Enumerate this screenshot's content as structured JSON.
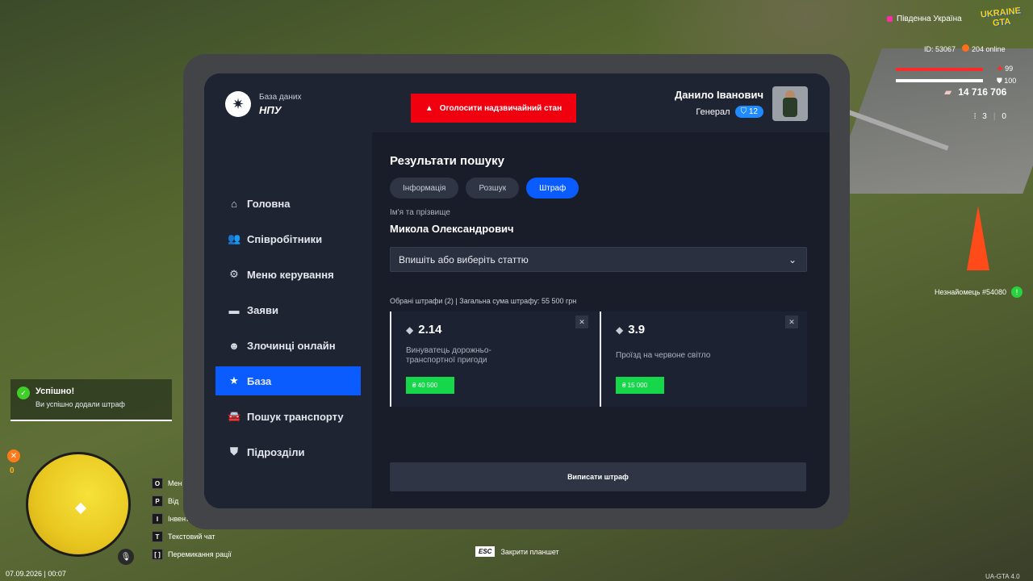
{
  "tablet": {
    "logo_sub": "База даних",
    "logo_main": "НПУ",
    "alarm_label": "Оголосити надзвичайний стан",
    "user_name": "Данило Іванович",
    "user_rank": "Генерал",
    "rank_level": "12",
    "nav": [
      {
        "label": "Головна",
        "icon": "home-icon"
      },
      {
        "label": "Співробітники",
        "icon": "people-icon"
      },
      {
        "label": "Меню керування",
        "icon": "gear-icon"
      },
      {
        "label": "Заяви",
        "icon": "folder-icon"
      },
      {
        "label": "Злочинці онлайн",
        "icon": "face-icon"
      },
      {
        "label": "База",
        "icon": "star-icon",
        "active": true
      },
      {
        "label": "Пошук транспорту",
        "icon": "car-icon"
      },
      {
        "label": "Підрозділи",
        "icon": "shield-icon"
      }
    ],
    "results_title": "Результати пошуку",
    "tabs": [
      "Інформація",
      "Розшук",
      "Штраф"
    ],
    "active_tab": "Штраф",
    "name_label": "Ім'я та прізвище",
    "name_value": "Микола Олександрович",
    "select_placeholder": "Впишіть або виберіть статтю",
    "summary": "Обрані штрафи (2) | Загальна сума штрафу: 55 500 грн",
    "fines": [
      {
        "code": "2.14",
        "desc": "Винуватець дорожньо-транспортної пригоди",
        "amount": "₴ 40 500"
      },
      {
        "code": "3.9",
        "desc": "Проїзд на червоне світло",
        "amount": "₴ 15 000"
      }
    ],
    "issue_button": "Виписати штраф"
  },
  "hud": {
    "region": "Південна Україна",
    "game_logo": "UKRAINE GTA",
    "player_id": "ID: 53067",
    "online": "204 online",
    "health": "99",
    "armor": "100",
    "money": "14 716 706",
    "ammo": "3",
    "ammo_reserve": "0",
    "stranger": "Незнайомець #54080",
    "map_counter": "0",
    "datetime": "07.09.2026 | 00:07",
    "version": "UA-GTA 4.0"
  },
  "toast": {
    "title": "Успішно!",
    "text": "Ви успішно додали штраф"
  },
  "keys": [
    {
      "key": "O",
      "label": "Мен"
    },
    {
      "key": "P",
      "label": "Від"
    },
    {
      "key": "I",
      "label": "Інвент"
    },
    {
      "key": "T",
      "label": "Текстовий чат"
    },
    {
      "key": "[ ]",
      "label": "Перемикання рації"
    }
  ],
  "esc_hint": {
    "key": "ESC",
    "label": "Закрити планшет"
  },
  "colors": {
    "accent": "#0b5cff",
    "alarm": "#f0000f",
    "money": "#16d64a"
  }
}
